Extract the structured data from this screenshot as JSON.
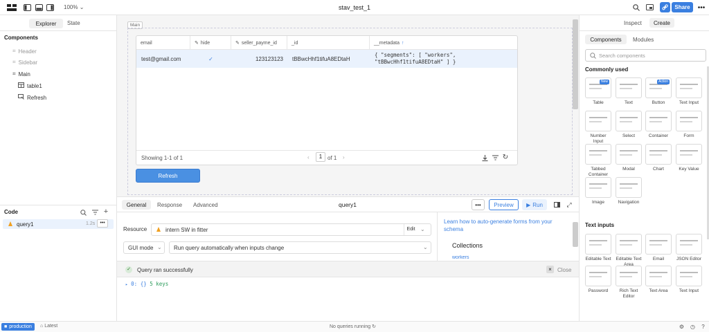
{
  "topbar": {
    "zoom": "100%",
    "title": "stav_test_1",
    "share": "Share"
  },
  "left": {
    "tabs": [
      "Explorer",
      "State"
    ],
    "components_heading": "Components",
    "tree": [
      {
        "label": "Header"
      },
      {
        "label": "Sidebar"
      },
      {
        "label": "Main"
      },
      {
        "label": "table1"
      },
      {
        "label": "Refresh"
      }
    ],
    "code_heading": "Code",
    "query": {
      "name": "query1",
      "time": "1.2s"
    }
  },
  "canvas": {
    "section_label": "Main",
    "table": {
      "columns": [
        "email",
        "hide",
        "seller_payme_id",
        "_id",
        "__metadata"
      ],
      "row": {
        "email": "test@gmail.com",
        "hide": "✓",
        "seller_payme_id": "123123123",
        "_id": "tBBwcHhf1tifuA8EDtaH",
        "metadata_line1": "{ \"segments\": [ \"workers\",",
        "metadata_line2": "\"tBBwcHhf1tifuA8EDtaH\" ] }"
      },
      "footer": {
        "showing": "Showing 1-1 of 1",
        "page": "1",
        "of": "of 1"
      }
    },
    "refresh_button": "Refresh"
  },
  "query_editor": {
    "tabs": [
      "General",
      "Response",
      "Advanced"
    ],
    "name": "query1",
    "preview": "Preview",
    "run": "Run",
    "resource_label": "Resource",
    "resource": "intern SW in fitter",
    "edit": "Edit",
    "mode": "GUI mode",
    "mode_option": "Run query automatically when inputs change",
    "hint": "Learn how to auto-generate forms from your schema",
    "collections": "Collections",
    "collection_item": "workers"
  },
  "result": {
    "message": "Query ran successfully",
    "close": "Close",
    "output_key": "0:",
    "output_braces": "{}",
    "output_value": "5 keys"
  },
  "right": {
    "tabs": [
      "Inspect",
      "Create"
    ],
    "subtabs": [
      "Components",
      "Modules"
    ],
    "search_placeholder": "Search components",
    "common_heading": "Commonly used",
    "common": [
      {
        "label": "Table",
        "badge": "New"
      },
      {
        "label": "Text"
      },
      {
        "label": "Button",
        "badge": "Action"
      },
      {
        "label": "Text Input"
      },
      {
        "label": "Number Input"
      },
      {
        "label": "Select"
      },
      {
        "label": "Container"
      },
      {
        "label": "Form"
      },
      {
        "label": "Tabbed Container"
      },
      {
        "label": "Modal"
      },
      {
        "label": "Chart"
      },
      {
        "label": "Key Value"
      },
      {
        "label": "Image"
      },
      {
        "label": "Navigation"
      }
    ],
    "text_inputs_heading": "Text inputs",
    "text_inputs": [
      {
        "label": "Editable Text"
      },
      {
        "label": "Editable Text Area"
      },
      {
        "label": "Email"
      },
      {
        "label": "JSON Editor"
      },
      {
        "label": "Password"
      },
      {
        "label": "Rich Text Editor"
      },
      {
        "label": "Text Area"
      },
      {
        "label": "Text Input"
      }
    ]
  },
  "status": {
    "env": "production",
    "branch": "Latest",
    "queries": "No queries running"
  }
}
